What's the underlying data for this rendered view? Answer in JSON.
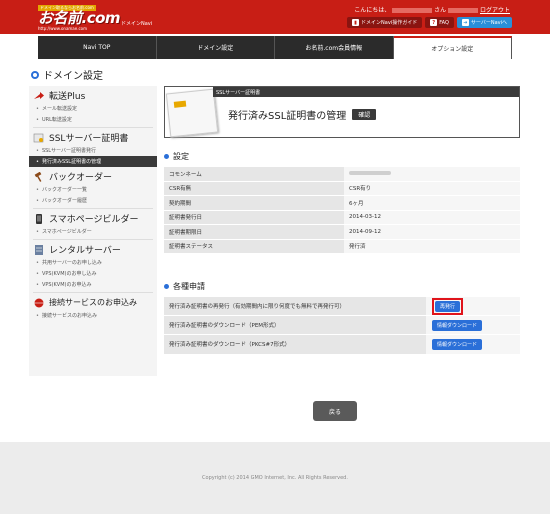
{
  "header": {
    "logo_tag": "ドメイン取るならお名前.com",
    "logo_main": "お名前.com",
    "logo_url": "http://www.onamae.com",
    "logo_sub": "ドメインNavi",
    "greeting": "こんにちは、",
    "greeting_suffix": "さん",
    "logout": "ログアウト",
    "buttons": [
      {
        "label": "ドメインNavi操作ガイド",
        "icon": "book-icon"
      },
      {
        "label": "FAQ",
        "icon": "question-icon"
      },
      {
        "label": "サーバーNaviへ",
        "icon": "arrow-icon"
      }
    ]
  },
  "nav": {
    "tabs": [
      {
        "label": "Navi TOP"
      },
      {
        "label": "ドメイン設定"
      },
      {
        "label": "お名前.com会員情報"
      },
      {
        "label": "オプション設定"
      }
    ]
  },
  "page_title": "ドメイン設定",
  "sidebar": {
    "sections": [
      {
        "title": "転送Plus",
        "icon": "arrow-icon",
        "items": [
          "メール転送設定",
          "URL転送設定"
        ]
      },
      {
        "title": "SSLサーバー証明書",
        "icon": "certificate-icon",
        "items": [
          "SSLサーバー証明書発行",
          "発行済みSSL証明書の管理"
        ]
      },
      {
        "title": "バックオーダー",
        "icon": "gavel-icon",
        "items": [
          "バックオーダー一覧",
          "バックオーダー履歴"
        ]
      },
      {
        "title": "スマホページビルダー",
        "icon": "smartphone-icon",
        "items": [
          "スマホページビルダー"
        ]
      },
      {
        "title": "レンタルサーバー",
        "icon": "server-icon",
        "items": [
          "共用サーバーのお申し込み",
          "VPS(KVM)のお申し込み",
          "VPS(KVM)のお申込み"
        ]
      },
      {
        "title": "接続サービスのお申込み",
        "icon": "globe-icon",
        "items": [
          "接続サービスのお申込み"
        ]
      }
    ]
  },
  "ssl_box": {
    "bar": "SSLサーバー証明書",
    "title": "発行済みSSL証明書の管理",
    "confirm": "確認"
  },
  "settings": {
    "title": "設定",
    "rows": [
      {
        "key": "コモンネーム",
        "value": ""
      },
      {
        "key": "CSR有無",
        "value": "CSR有り"
      },
      {
        "key": "契約期間",
        "value": "6ヶ月"
      },
      {
        "key": "証明書発行日",
        "value": "2014-03-12"
      },
      {
        "key": "証明書期限日",
        "value": "2014-09-12"
      },
      {
        "key": "証明書ステータス",
        "value": "発行済"
      }
    ]
  },
  "applications": {
    "title": "各種申請",
    "rows": [
      {
        "label": "発行済み証明書の再発行（有効期間内に限り何度でも無料で再発行可）",
        "button": "再発行"
      },
      {
        "label": "発行済み証明書のダウンロード（PEM形式）",
        "button": "情報ダウンロード"
      },
      {
        "label": "発行済み証明書のダウンロード（PKCS#7形式）",
        "button": "情報ダウンロード"
      }
    ]
  },
  "back_button": "戻る",
  "footer": {
    "copyright": "Copyright (c) 2014 GMO Internet, Inc. All Rights Reserved."
  }
}
